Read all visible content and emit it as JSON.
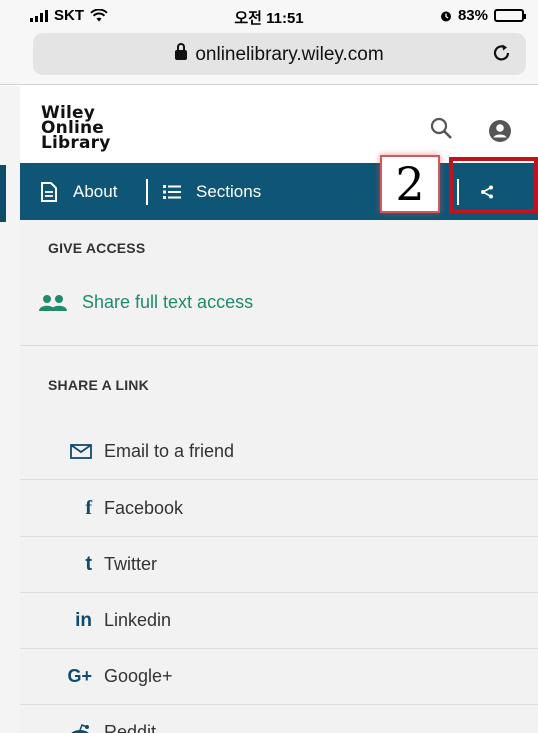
{
  "status_bar": {
    "carrier": "SKT",
    "time": "오전 11:51",
    "battery": "83%",
    "battery_level": 0.83
  },
  "browser": {
    "url": "onlinelibrary.wiley.com"
  },
  "site": {
    "logo_lines": [
      "Wiley",
      "Online",
      "Library"
    ]
  },
  "nav": {
    "about_label": "About",
    "sections_label": "Sections"
  },
  "annotation": {
    "step_number": "2",
    "highlight_color": "#c3121f"
  },
  "share_menu": {
    "give_access_title": "GIVE ACCESS",
    "share_full_text_label": "Share full text access",
    "share_link_title": "SHARE A LINK",
    "links": [
      {
        "label": "Email to a friend",
        "icon": "envelope-icon"
      },
      {
        "label": "Facebook",
        "icon": "facebook-icon"
      },
      {
        "label": "Twitter",
        "icon": "twitter-icon"
      },
      {
        "label": "Linkedin",
        "icon": "linkedin-icon"
      },
      {
        "label": "Google+",
        "icon": "google-plus-icon"
      },
      {
        "label": "Reddit",
        "icon": "reddit-icon"
      }
    ]
  },
  "colors": {
    "nav_bg": "#0f5576",
    "accent_green": "#1f8a6c",
    "icon_blue": "#0f4b6b"
  }
}
